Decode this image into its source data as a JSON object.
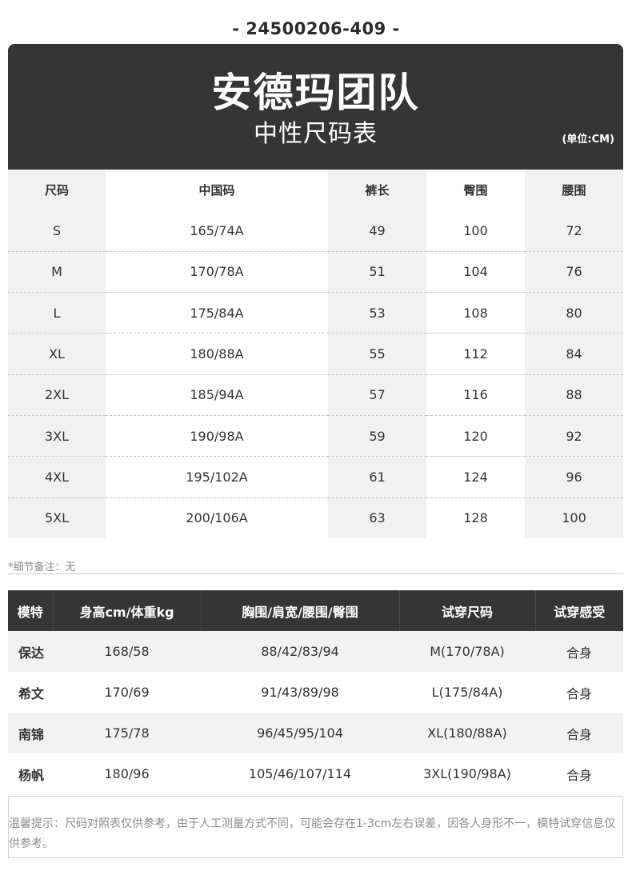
{
  "product_code": "-  24500206-409  -",
  "header": {
    "brand": "安德玛团队",
    "title": "中性尺码表",
    "unit": "(单位:CM)"
  },
  "size_table": {
    "columns": [
      "尺码",
      "中国码",
      "裤长",
      "臀围",
      "腰围"
    ],
    "rows": [
      [
        "S",
        "165/74A",
        "49",
        "100",
        "72"
      ],
      [
        "M",
        "170/78A",
        "51",
        "104",
        "76"
      ],
      [
        "L",
        "175/84A",
        "53",
        "108",
        "80"
      ],
      [
        "XL",
        "180/88A",
        "55",
        "112",
        "84"
      ],
      [
        "2XL",
        "185/94A",
        "57",
        "116",
        "88"
      ],
      [
        "3XL",
        "190/98A",
        "59",
        "120",
        "92"
      ],
      [
        "4XL",
        "195/102A",
        "61",
        "124",
        "96"
      ],
      [
        "5XL",
        "200/106A",
        "63",
        "128",
        "100"
      ]
    ]
  },
  "detail_note": "*细节备注：无",
  "model_table": {
    "columns": [
      "模特",
      "身高cm/体重kg",
      "胸围/肩宽/腰围/臀围",
      "试穿尺码",
      "试穿感受"
    ],
    "rows": [
      [
        "保达",
        "168/58",
        "88/42/83/94",
        "M(170/78A)",
        "合身"
      ],
      [
        "希文",
        "170/69",
        "91/43/89/98",
        "L(175/84A)",
        "合身"
      ],
      [
        "南锦",
        "175/78",
        "96/45/95/104",
        "XL(180/88A)",
        "合身"
      ],
      [
        "杨帆",
        "180/96",
        "105/46/107/114",
        "3XL(190/98A)",
        "合身"
      ]
    ]
  },
  "tip": "温馨提示：尺码对照表仅供参考，由于人工测量方式不同，可能会存在1-3cm左右误差，因各人身形不一，模特试穿信息仅供参考。"
}
